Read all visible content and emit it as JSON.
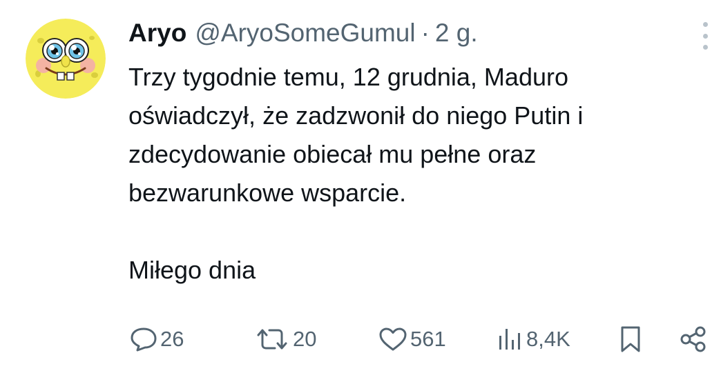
{
  "tweet": {
    "author": {
      "name": "Aryo",
      "handle": "@AryoSomeGumul",
      "separator": "·",
      "time": "2 g."
    },
    "avatar_icon": "spongebob-face-avatar",
    "more_icon": "vertical-ellipsis-icon",
    "text": {
      "line1": "Trzy tygodnie temu, 12 grudnia, Maduro",
      "line2": "oświadczył, że zadzwonił do niego Putin i",
      "line3": "zdecydowanie obiecał mu pełne oraz",
      "line4": "bezwarunkowe wsparcie.",
      "line5": "Miłego dnia"
    },
    "actions": {
      "replies": {
        "icon": "reply-bubble-icon",
        "count": "26"
      },
      "retweets": {
        "icon": "retweet-icon",
        "count": "20"
      },
      "likes": {
        "icon": "heart-icon",
        "count": "561"
      },
      "views": {
        "icon": "analytics-bars-icon",
        "count": "8,4K"
      },
      "bookmark": {
        "icon": "bookmark-icon"
      },
      "share": {
        "icon": "share-icon"
      }
    },
    "colors": {
      "text": "#0f1419",
      "secondary": "#536471",
      "avatar_yellow": "#f5ec5a"
    }
  }
}
